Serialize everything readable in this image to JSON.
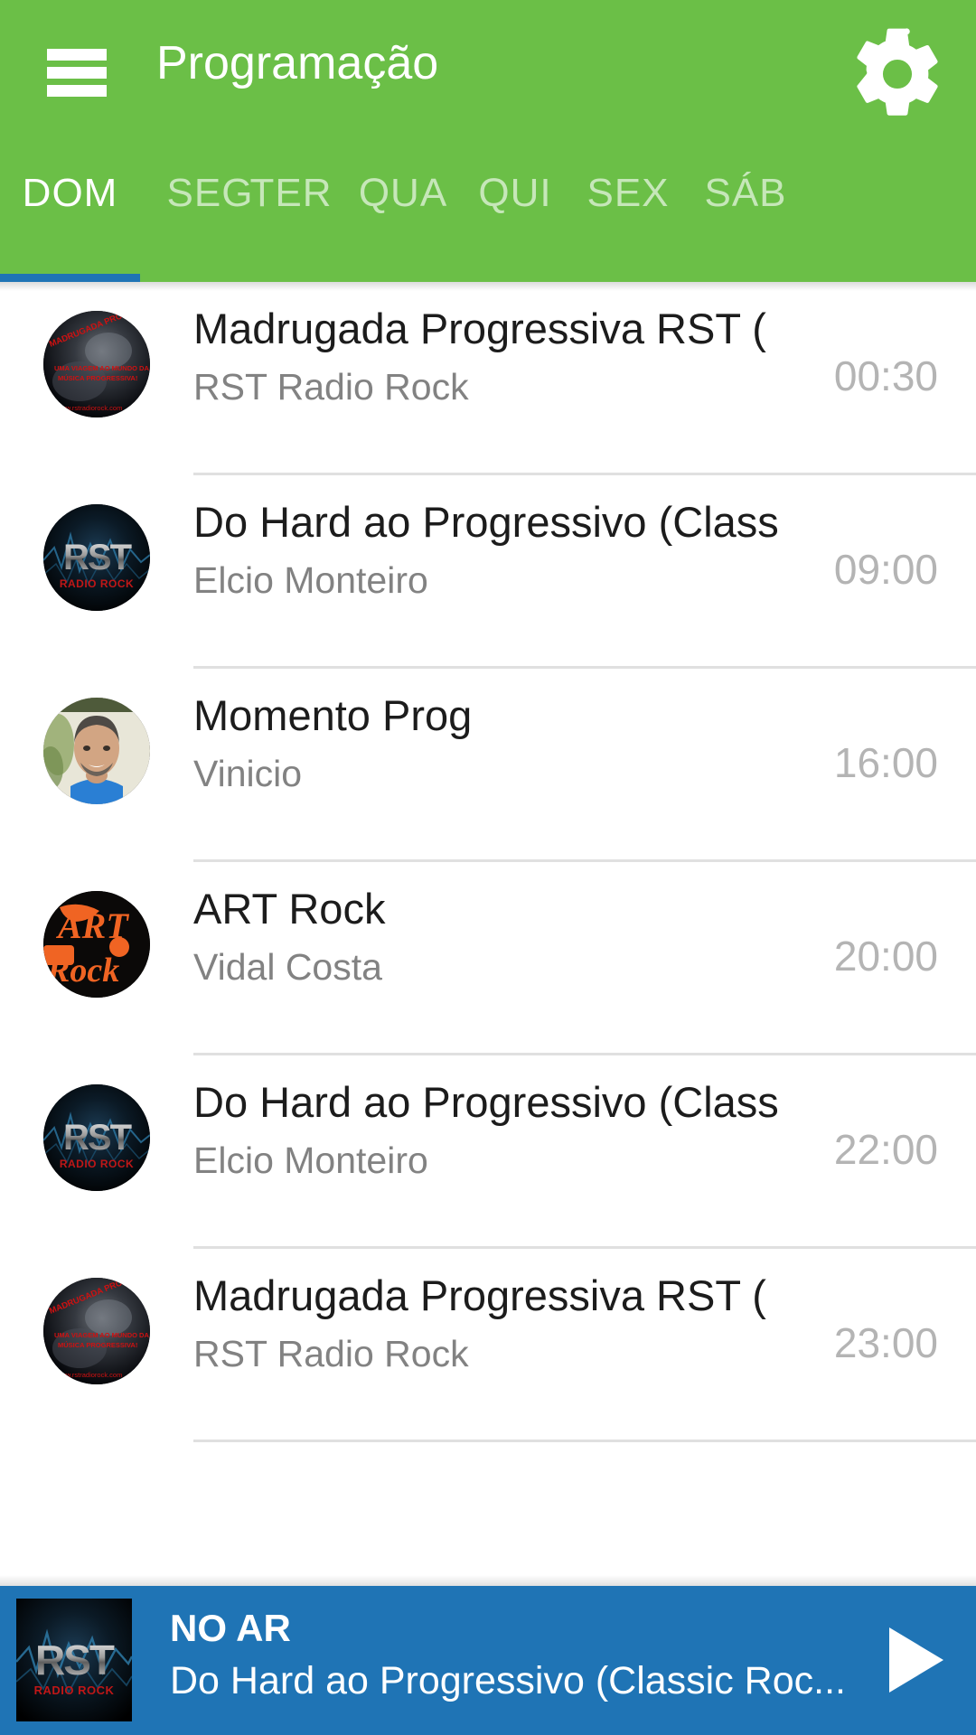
{
  "app": {
    "accent_green": "#6BBF47",
    "accent_blue": "#1F74B5",
    "title": "Programação",
    "menu_icon": "hamburger-menu-icon",
    "settings_icon": "gear-icon"
  },
  "tabs": {
    "active_index": 0,
    "items": [
      {
        "label": "DOM"
      },
      {
        "label": "SEG"
      },
      {
        "label": "TER"
      },
      {
        "label": "QUA"
      },
      {
        "label": "QUI"
      },
      {
        "label": "SEX"
      },
      {
        "label": "SÁB"
      }
    ]
  },
  "schedule": {
    "rows": [
      {
        "title": "Madrugada Progressiva RST ( ",
        "host": "RST Radio Rock",
        "time": "00:30",
        "avatar": "madrugada-progressiva-logo"
      },
      {
        "title": "Do Hard ao Progressivo (Class",
        "host": "Elcio Monteiro",
        "time": "09:00",
        "avatar": "rst-radio-rock-logo"
      },
      {
        "title": "Momento Prog",
        "host": "Vinicio",
        "time": "16:00",
        "avatar": "vinicio-photo"
      },
      {
        "title": "ART Rock",
        "host": "Vidal Costa",
        "time": "20:00",
        "avatar": "art-rock-logo"
      },
      {
        "title": "Do Hard ao Progressivo (Class",
        "host": "Elcio Monteiro",
        "time": "22:00",
        "avatar": "rst-radio-rock-logo"
      },
      {
        "title": "Madrugada Progressiva RST ( ",
        "host": "RST Radio Rock",
        "time": "23:00",
        "avatar": "madrugada-progressiva-logo"
      }
    ]
  },
  "player": {
    "status": "NO AR",
    "program": "Do Hard ao Progressivo (Classic Roc...",
    "thumb": "rst-radio-rock-logo",
    "play_icon": "play-icon"
  }
}
